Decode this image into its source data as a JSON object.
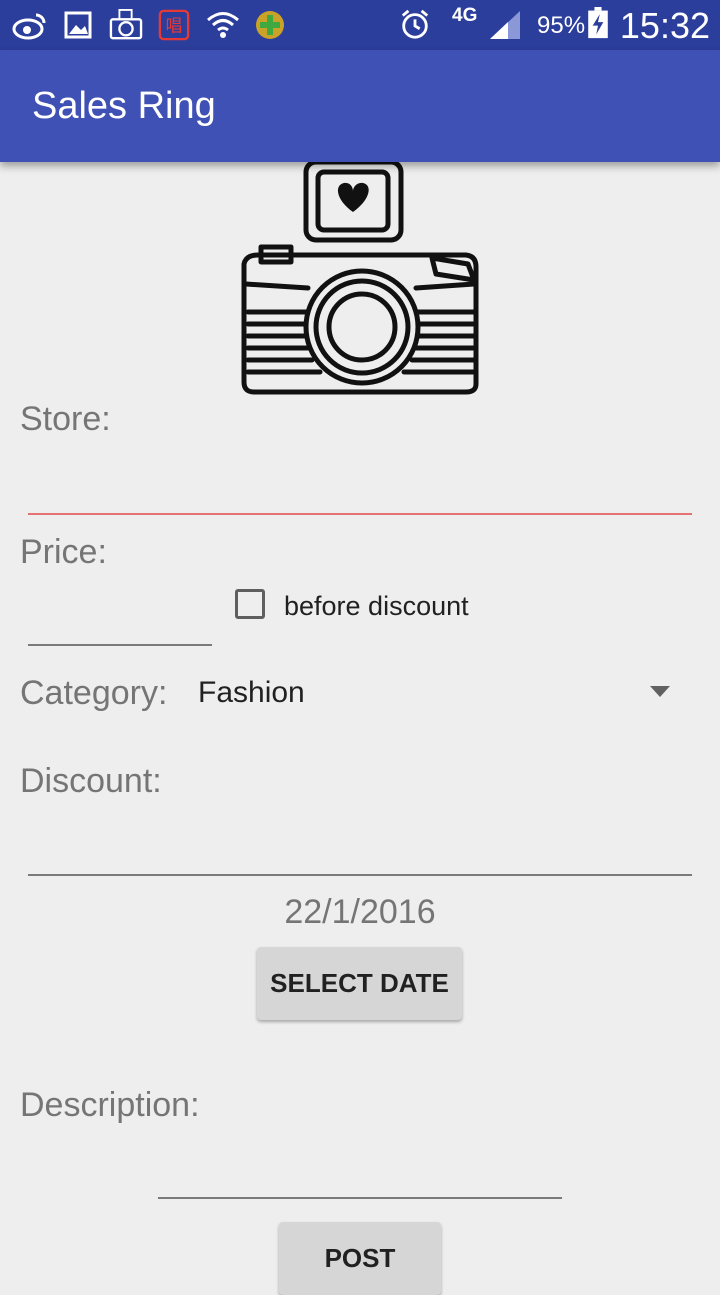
{
  "status_bar": {
    "network": "4G",
    "battery": "95%",
    "time": "15:32",
    "icons": [
      "weibo-icon",
      "gallery-icon",
      "camera-app-icon",
      "chat-app-icon",
      "wifi-icon",
      "plus-app-icon",
      "alarm-icon",
      "signal-icon",
      "battery-icon"
    ]
  },
  "app_bar": {
    "title": "Sales Ring"
  },
  "form": {
    "store_label": "Store:",
    "store_value": "",
    "price_label": "Price:",
    "price_value": "",
    "before_discount_label": "before discount",
    "before_discount_checked": false,
    "category_label": "Category:",
    "category_value": "Fashion",
    "discount_label": "Discount:",
    "discount_value": "",
    "date_value": "22/1/2016",
    "select_date_label": "SELECT DATE",
    "description_label": "Description:",
    "description_value": "",
    "post_label": "POST"
  },
  "colors": {
    "app_bar": "#3f51b5",
    "status_bar": "#2c3e9c",
    "focused_underline": "#e57373"
  }
}
